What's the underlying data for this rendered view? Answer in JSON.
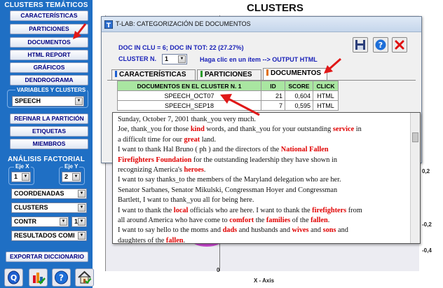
{
  "app": {
    "heading": "CLUSTERS"
  },
  "left": {
    "title": "CLUSTERS TEMÁTICOS",
    "buttons": [
      "CARACTERÍSTICAS",
      "PARTICIONES",
      "DOCUMENTOS",
      "HTML REPORT",
      "GRÁFICOS",
      "DENDROGRAMA"
    ],
    "vars_label": "VARIABLES Y CLUSTERS",
    "vars_combo": "SPEECH",
    "buttons2": [
      "REFINAR LA PARTICIÓN",
      "ETIQUETAS",
      "MIEMBROS"
    ],
    "factorial_title": "ANÁLISIS FACTORIAL",
    "eje_x_label": "Eje X",
    "eje_y_label": "Eje Y",
    "eje_x_value": "1",
    "eje_y_value": "2",
    "combo_coord": "COORDENADAS",
    "combo_clusters": "CLUSTERS",
    "combo_contr": "CONTR",
    "combo_contr_n": "1",
    "combo_results": "RESULTADOS COMI",
    "export_button": "EXPORTAR DICCIONARIO"
  },
  "plot": {
    "y_ticks": [
      "0,2",
      "-0,2",
      "-0,4"
    ],
    "x_tick": "0",
    "x_label": "X - Axis"
  },
  "dialog": {
    "title": "T-LAB: CATEGORIZACIÓN DE DOCUMENTOS",
    "info": "DOC IN CLU = 6; DOC IN TOT: 22 (27.27%)",
    "cluster_label": "CLUSTER N.",
    "cluster_value": "1",
    "hint": "Haga clic en un ítem --> OUTPUT HTML",
    "tabs": [
      "CARACTERÍSTICAS",
      "PARTICIONES",
      "DOCUMENTOS"
    ],
    "table": {
      "headers": [
        "DOCUMENTOS EN EL CLUSTER N. 1",
        "ID",
        "SCORE",
        "CLICK"
      ],
      "rows": [
        [
          "SPEECH_OCT07",
          "21",
          "0,604",
          "HTML"
        ],
        [
          "SPEECH_SEP18",
          "7",
          "0,595",
          "HTML"
        ]
      ]
    }
  },
  "popup": {
    "lines": [
      [
        {
          "t": "Sunday, October 7, 2001 thank_you very much."
        }
      ],
      [
        {
          "t": "Joe, thank_you for those "
        },
        {
          "t": "kind",
          "k": 1
        },
        {
          "t": " words, and thank_you for your outstanding "
        },
        {
          "t": "service",
          "k": 1
        },
        {
          "t": " in"
        }
      ],
      [
        {
          "t": "a difficult time for our "
        },
        {
          "t": "great",
          "k": 1
        },
        {
          "t": " land."
        }
      ],
      [
        {
          "t": "I want to thank Hal Bruno ( ph ) and the directors of the "
        },
        {
          "t": "National Fallen",
          "k": 1
        }
      ],
      [
        {
          "t": "Firefighters Foundation",
          "k": 1
        },
        {
          "t": " for the outstanding leadership they have shown in"
        }
      ],
      [
        {
          "t": "recognizing America's "
        },
        {
          "t": "heroes",
          "k": 1
        },
        {
          "t": "."
        }
      ],
      [
        {
          "t": "I want to say thanks_to the members of the Maryland delegation who are her."
        }
      ],
      [
        {
          "t": "Senator Sarbanes, Senator Mikulski, Congressman Hoyer and Congressman"
        }
      ],
      [
        {
          "t": "Bartlett, I want to thank_you all for being here."
        }
      ],
      [
        {
          "t": "I want to thank the "
        },
        {
          "t": "local",
          "k": 1
        },
        {
          "t": " officials who are here. I want to thank the "
        },
        {
          "t": "firefighters",
          "k": 1
        },
        {
          "t": " from"
        }
      ],
      [
        {
          "t": "all around America who have come to "
        },
        {
          "t": "comfort",
          "k": 1
        },
        {
          "t": " the "
        },
        {
          "t": "families",
          "k": 1
        },
        {
          "t": " of the "
        },
        {
          "t": "fallen",
          "k": 1
        },
        {
          "t": "."
        }
      ],
      [
        {
          "t": "I want to say hello to the moms and "
        },
        {
          "t": "dads",
          "k": 1
        },
        {
          "t": " and husbands and "
        },
        {
          "t": "wives",
          "k": 1
        },
        {
          "t": " and "
        },
        {
          "t": "sons",
          "k": 1
        },
        {
          "t": " and"
        }
      ],
      [
        {
          "t": "daughters of the "
        },
        {
          "t": "fallen",
          "k": 1
        },
        {
          "t": "."
        }
      ]
    ]
  }
}
